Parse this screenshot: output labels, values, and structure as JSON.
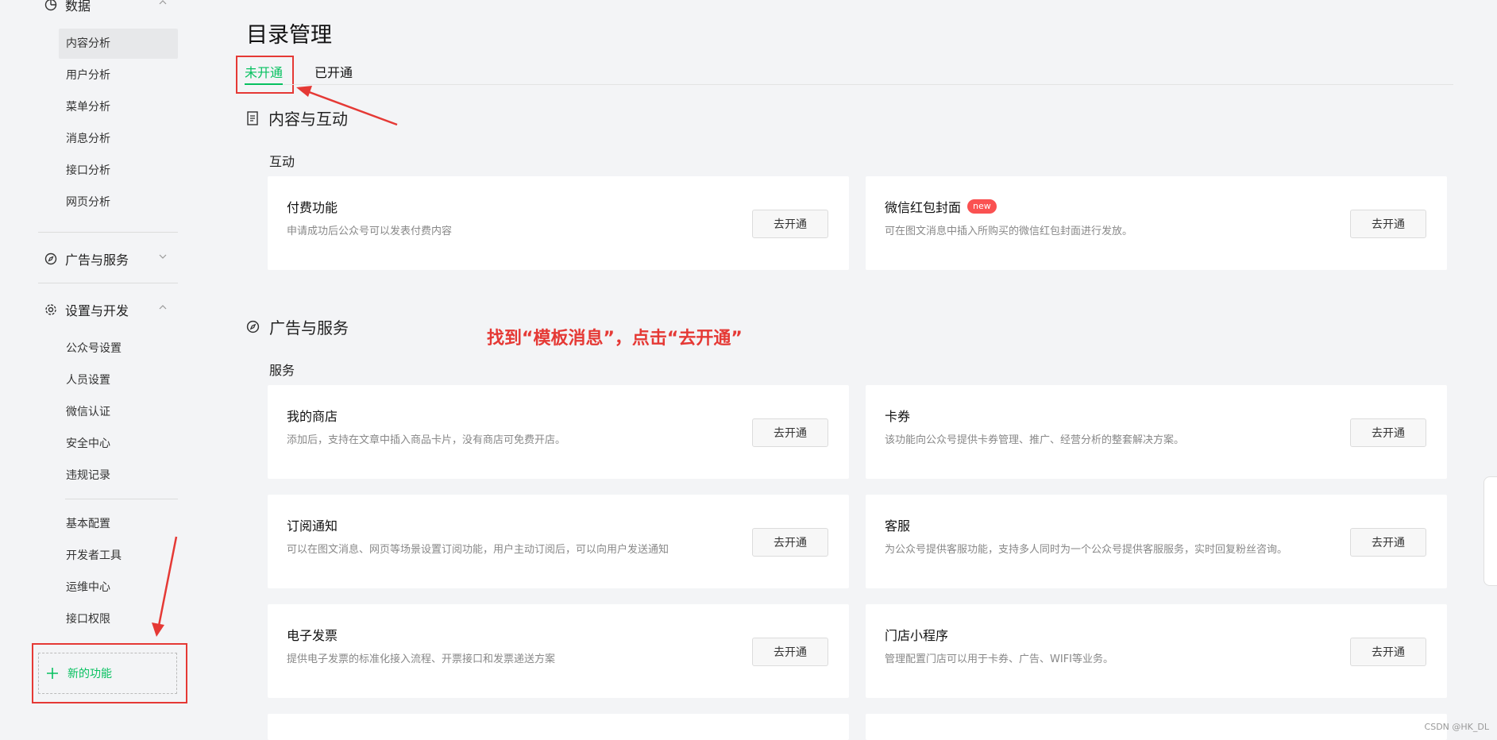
{
  "sidebar": {
    "data_group": "数据",
    "data_items": [
      "内容分析",
      "用户分析",
      "菜单分析",
      "消息分析",
      "接口分析",
      "网页分析"
    ],
    "ads_group": "广告与服务",
    "settings_group": "设置与开发",
    "settings_items": [
      "公众号设置",
      "人员设置",
      "微信认证",
      "安全中心",
      "违规记录"
    ],
    "dev_items": [
      "基本配置",
      "开发者工具",
      "运维中心",
      "接口权限"
    ],
    "new_function": "新的功能"
  },
  "main": {
    "title": "目录管理",
    "tabs": [
      "未开通",
      "已开通"
    ],
    "section1": {
      "title": "内容与互动",
      "sub": "互动",
      "cards": [
        {
          "title": "付费功能",
          "desc": "申请成功后公众号可以发表付费内容",
          "button": "去开通"
        },
        {
          "title": "微信红包封面",
          "badge": "new",
          "desc": "可在图文消息中插入所购买的微信红包封面进行发放。",
          "button": "去开通"
        }
      ]
    },
    "section2": {
      "title": "广告与服务",
      "sub": "服务",
      "cards": [
        {
          "title": "我的商店",
          "desc": "添加后，支持在文章中插入商品卡片，没有商店可免费开店。",
          "button": "去开通"
        },
        {
          "title": "卡券",
          "desc": "该功能向公众号提供卡券管理、推广、经营分析的整套解决方案。",
          "button": "去开通"
        },
        {
          "title": "订阅通知",
          "desc": "可以在图文消息、网页等场景设置订阅功能，用户主动订阅后，可以向用户发送通知",
          "button": "去开通"
        },
        {
          "title": "客服",
          "desc": "为公众号提供客服功能，支持多人同时为一个公众号提供客服服务，实时回复粉丝咨询。",
          "button": "去开通"
        },
        {
          "title": "电子发票",
          "desc": "提供电子发票的标准化接入流程、开票接口和发票递送方案",
          "button": "去开通"
        },
        {
          "title": "门店小程序",
          "desc": "管理配置门店可以用于卡券、广告、WIFI等业务。",
          "button": "去开通"
        }
      ]
    }
  },
  "annotation": "找到“模板消息”，点击“去开通”",
  "watermark": "CSDN @HK_DL",
  "colors": {
    "accent": "#07c160",
    "annotation": "#e53935",
    "badge": "#fa5151"
  }
}
